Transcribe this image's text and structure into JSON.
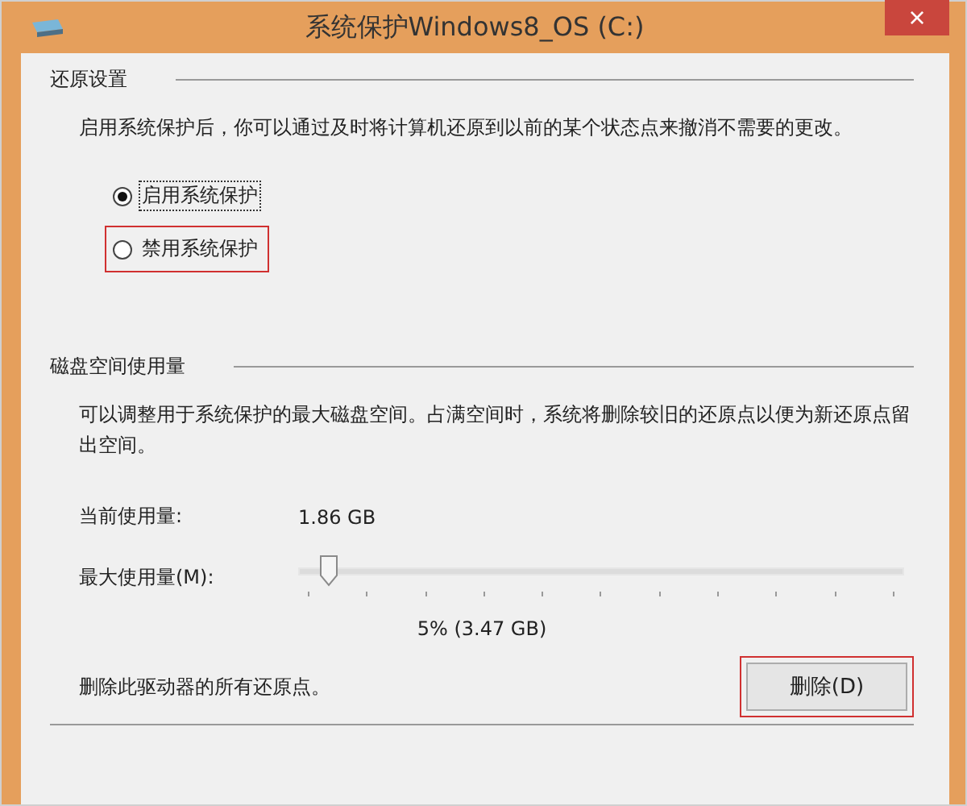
{
  "window": {
    "title": "系统保护Windows8_OS (C:)",
    "close": "×"
  },
  "restore_settings": {
    "heading": "还原设置",
    "description": "启用系统保护后，你可以通过及时将计算机还原到以前的某个状态点来撤消不需要的更改。",
    "options": [
      {
        "label": "启用系统保护",
        "selected": true,
        "highlighted": false
      },
      {
        "label": "禁用系统保护",
        "selected": false,
        "highlighted": true
      }
    ]
  },
  "disk_usage": {
    "heading": "磁盘空间使用量",
    "description": "可以调整用于系统保护的最大磁盘空间。占满空间时，系统将删除较旧的还原点以便为新还原点留出空间。",
    "current_label": "当前使用量:",
    "current_value": "1.86 GB",
    "max_label": "最大使用量(M):",
    "max_slider": {
      "level": 0.05
    },
    "max_reading": "5% (3.47 GB)",
    "delete_label": "删除此驱动器的所有还原点。",
    "delete_button": {
      "label": "删除(D)",
      "highlighted": true
    }
  }
}
